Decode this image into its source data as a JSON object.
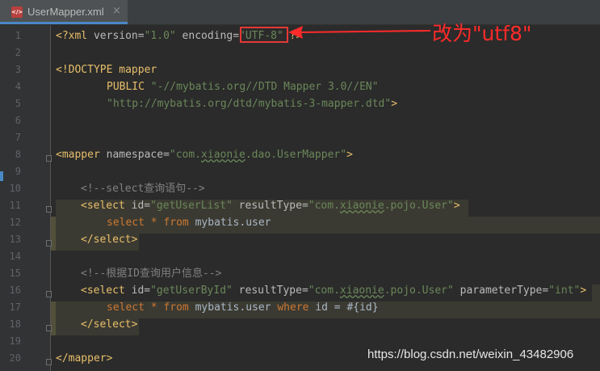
{
  "tab": {
    "title": "UserMapper.xml",
    "close": "×",
    "icon": "xml-file-icon",
    "icon_text": "</>"
  },
  "line_numbers": [
    "1",
    "2",
    "3",
    "4",
    "5",
    "6",
    "7",
    "8",
    "9",
    "10",
    "11",
    "12",
    "13",
    "14",
    "15",
    "16",
    "17",
    "18",
    "19",
    "20"
  ],
  "code": {
    "l1": {
      "open": "<?xml ",
      "a1": "version",
      "eq1": "=",
      "v1": "\"1.0\"",
      "a2": " encoding",
      "eq2": "=",
      "v2": "\"UTF-8\"",
      "close": " ?>"
    },
    "l3": {
      "text": "<!DOCTYPE mapper"
    },
    "l4": {
      "kw": "PUBLIC ",
      "val": "\"-//mybatis.org//DTD Mapper 3.0//EN\""
    },
    "l5": {
      "val": "\"http://mybatis.org/dtd/mybatis-3-mapper.dtd\"",
      "close": ">"
    },
    "l8": {
      "open": "<mapper ",
      "attr": "namespace",
      "eq": "=",
      "v1": "\"com.",
      "v2": "xiaonie",
      "v3": ".dao.UserMapper\"",
      "close": ">"
    },
    "l10": {
      "text": "<!--select查询语句-->"
    },
    "l11": {
      "open": "<select ",
      "a1": "id",
      "eq1": "=",
      "v1": "\"getUserList\"",
      "a2": " resultType",
      "eq2": "=",
      "v2a": "\"com.",
      "v2b": "xiaonie",
      "v2c": ".pojo.User\"",
      "close": ">"
    },
    "l12": {
      "k1": "select ",
      "k2": "* ",
      "k3": "from ",
      "rest": "mybatis.user"
    },
    "l13": {
      "text": "</select>"
    },
    "l15": {
      "text": "<!--根据ID查询用户信息-->"
    },
    "l16": {
      "open": "<select ",
      "a1": "id",
      "eq1": "=",
      "v1": "\"getUserById\"",
      "a2": " resultType",
      "eq2": "=",
      "v2a": "\"com.",
      "v2b": "xiaonie",
      "v2c": ".pojo.User\"",
      "a3": " parameterType",
      "eq3": "=",
      "v3": "\"int\"",
      "close": ">"
    },
    "l17": {
      "k1": "select ",
      "k2": "* ",
      "k3": "from ",
      "mid": "mybatis.user ",
      "k4": "where ",
      "rest": "id = #{id}"
    },
    "l18": {
      "text": "</select>"
    },
    "l20": {
      "text": "</mapper>"
    }
  },
  "annotation": {
    "text": "改为\"utf8\""
  },
  "watermark": {
    "text": "https://blog.csdn.net/weixin_43482906"
  },
  "colors": {
    "background": "#2b2b2b",
    "tag": "#e8bf6a",
    "string": "#6a8759",
    "keyword": "#cc7832",
    "comment": "#808080",
    "annotation": "#ff2a2a"
  }
}
